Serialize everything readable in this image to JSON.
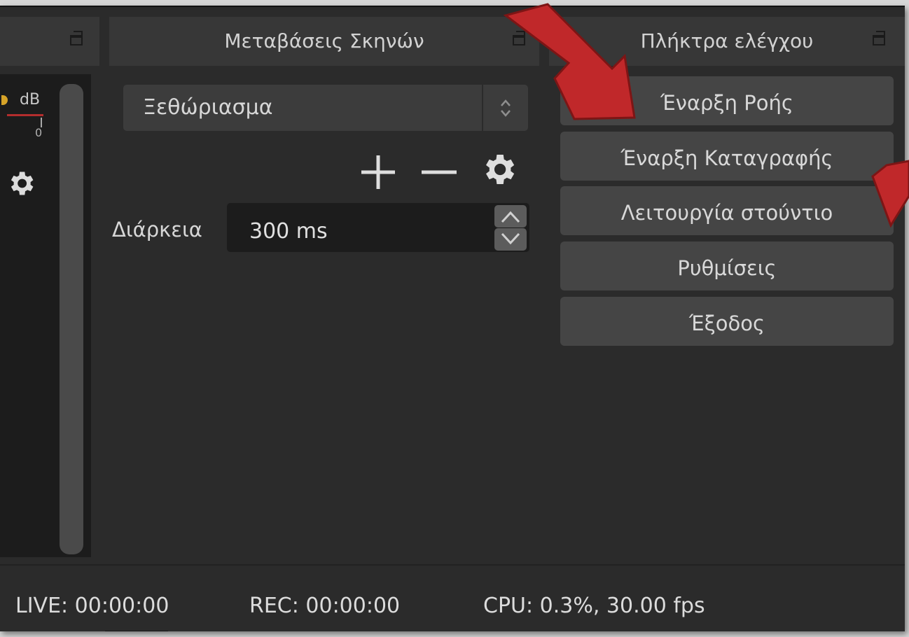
{
  "docks": {
    "transitions": {
      "title": "Μεταβάσεις Σκηνών"
    },
    "controls": {
      "title": "Πλήκτρα ελέγχου"
    }
  },
  "mixer": {
    "db_label": "dB",
    "zero_tick": "0"
  },
  "transitions": {
    "selected": "Ξεθώριασμα",
    "duration_label": "Διάρκεια",
    "duration_value": "300 ms"
  },
  "controls": {
    "start_streaming": "Έναρξη Ροής",
    "start_recording": "Έναρξη Καταγραφής",
    "studio_mode": "Λειτουργία στούντιο",
    "settings": "Ρυθμίσεις",
    "exit": "Έξοδος"
  },
  "status": {
    "live": "LIVE: 00:00:00",
    "rec": "REC: 00:00:00",
    "cpu": "CPU: 0.3%, 30.00 fps"
  },
  "colors": {
    "annotation_arrow": "#c0282a",
    "panel_bg": "#2b2b2b",
    "button_bg": "#454545"
  }
}
